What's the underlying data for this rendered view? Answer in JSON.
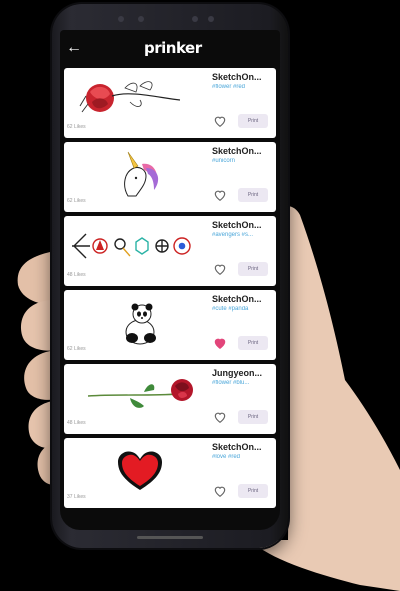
{
  "app": {
    "logo": "prinker",
    "back_icon": "back-arrow-icon"
  },
  "cards": [
    {
      "likes": "62 Likes",
      "author": "SketchOn...",
      "tags": "#flower #red",
      "liked": false,
      "print_label": "Print",
      "art": "rose-sketch"
    },
    {
      "likes": "62 Likes",
      "author": "SketchOn...",
      "tags": "#unicorn",
      "liked": false,
      "print_label": "Print",
      "art": "unicorn"
    },
    {
      "likes": "48 Likes",
      "author": "SketchOn...",
      "tags": "#avengers #s...",
      "liked": false,
      "print_label": "Print",
      "art": "avengers-icons"
    },
    {
      "likes": "62 Likes",
      "author": "SketchOn...",
      "tags": "#cute #panda",
      "liked": true,
      "print_label": "Print",
      "art": "panda"
    },
    {
      "likes": "48 Likes",
      "author": "Jungyeon...",
      "tags": "#flower #blu...",
      "liked": false,
      "print_label": "Print",
      "art": "red-rose"
    },
    {
      "likes": "37 Likes",
      "author": "SketchOn...",
      "tags": "#love #red",
      "liked": false,
      "print_label": "Print",
      "art": "heart"
    }
  ],
  "colors": {
    "tag": "#4aa6d9",
    "liked_heart": "#e2457a",
    "print_bg": "#ece8f2"
  }
}
